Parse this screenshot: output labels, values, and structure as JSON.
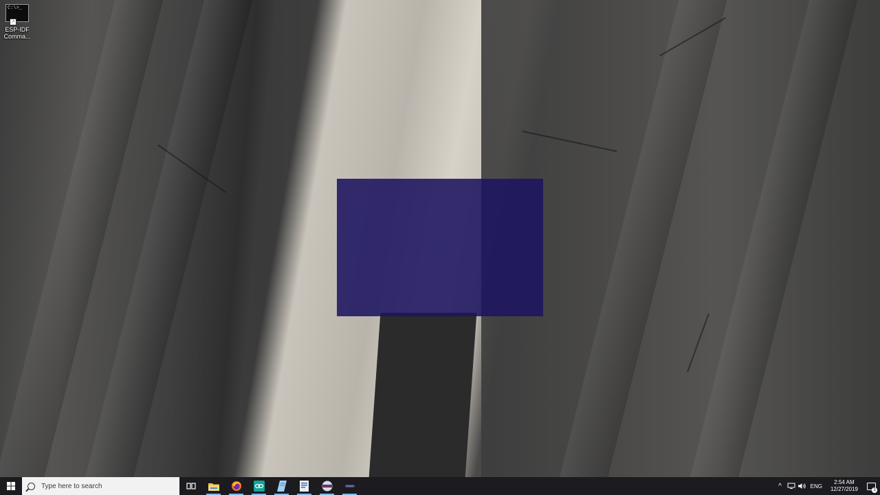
{
  "desktop": {
    "icons": [
      {
        "label": "ESP-IDF Comma...",
        "thumb_text": "C:\\>_",
        "icon": "command-prompt-icon"
      }
    ],
    "overlay_color": "#1c1460"
  },
  "taskbar": {
    "search": {
      "placeholder": "Type here to search",
      "value": ""
    },
    "apps": [
      {
        "icon": "task-view-icon"
      },
      {
        "icon": "file-explorer-icon"
      },
      {
        "icon": "firefox-icon"
      },
      {
        "icon": "arduino-icon"
      },
      {
        "icon": "notepad-icon"
      },
      {
        "icon": "document-icon"
      },
      {
        "icon": "esp-idf-app-icon"
      },
      {
        "icon": "esp-idf-app-icon-2"
      }
    ],
    "tray": {
      "chevron": "^",
      "language": "ENG",
      "time": "2:54 AM",
      "date": "12/27/2019",
      "notification_count": "3"
    }
  }
}
